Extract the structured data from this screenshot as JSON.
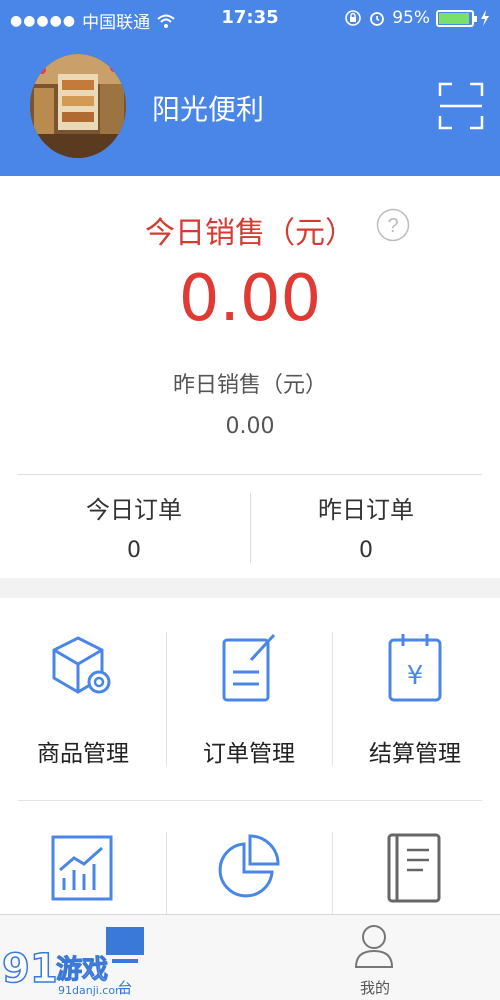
{
  "status_bar": {
    "carrier": "中国联通",
    "time": "17:35",
    "battery": "95%",
    "battery_level": 0.95
  },
  "header": {
    "store_name": "阳光便利",
    "scan_icon": "scan-icon",
    "avatar_icon": "store-photo"
  },
  "sales": {
    "today_label": "今日销售（元）",
    "today_value": "0.00",
    "help_icon": "question-circle-icon",
    "yesterday_label": "昨日销售（元）",
    "yesterday_value": "0.00"
  },
  "orders": {
    "today_label": "今日订单",
    "today_value": "0",
    "yesterday_label": "昨日订单",
    "yesterday_value": "0"
  },
  "menu": {
    "items": [
      {
        "label": "商品管理",
        "icon": "product-box-gear-icon"
      },
      {
        "label": "订单管理",
        "icon": "order-document-icon"
      },
      {
        "label": "结算管理",
        "icon": "settlement-calendar-yen-icon"
      },
      {
        "label": "",
        "icon": "bar-chart-trend-icon"
      },
      {
        "label": "",
        "icon": "pie-chart-icon"
      },
      {
        "label": "",
        "icon": "book-icon"
      }
    ]
  },
  "tabbar": {
    "tabs": [
      {
        "label": "台",
        "icon": "monitor-icon",
        "active": true
      },
      {
        "label": "我的",
        "icon": "user-icon",
        "active": false
      }
    ]
  },
  "watermark": {
    "brand": "91游戏",
    "url": "91danji.com"
  },
  "colors": {
    "header": "#4a86e8",
    "accent_red": "#e03a34",
    "icon_blue": "#4a86e8",
    "active_tab": "#3b79d8"
  }
}
